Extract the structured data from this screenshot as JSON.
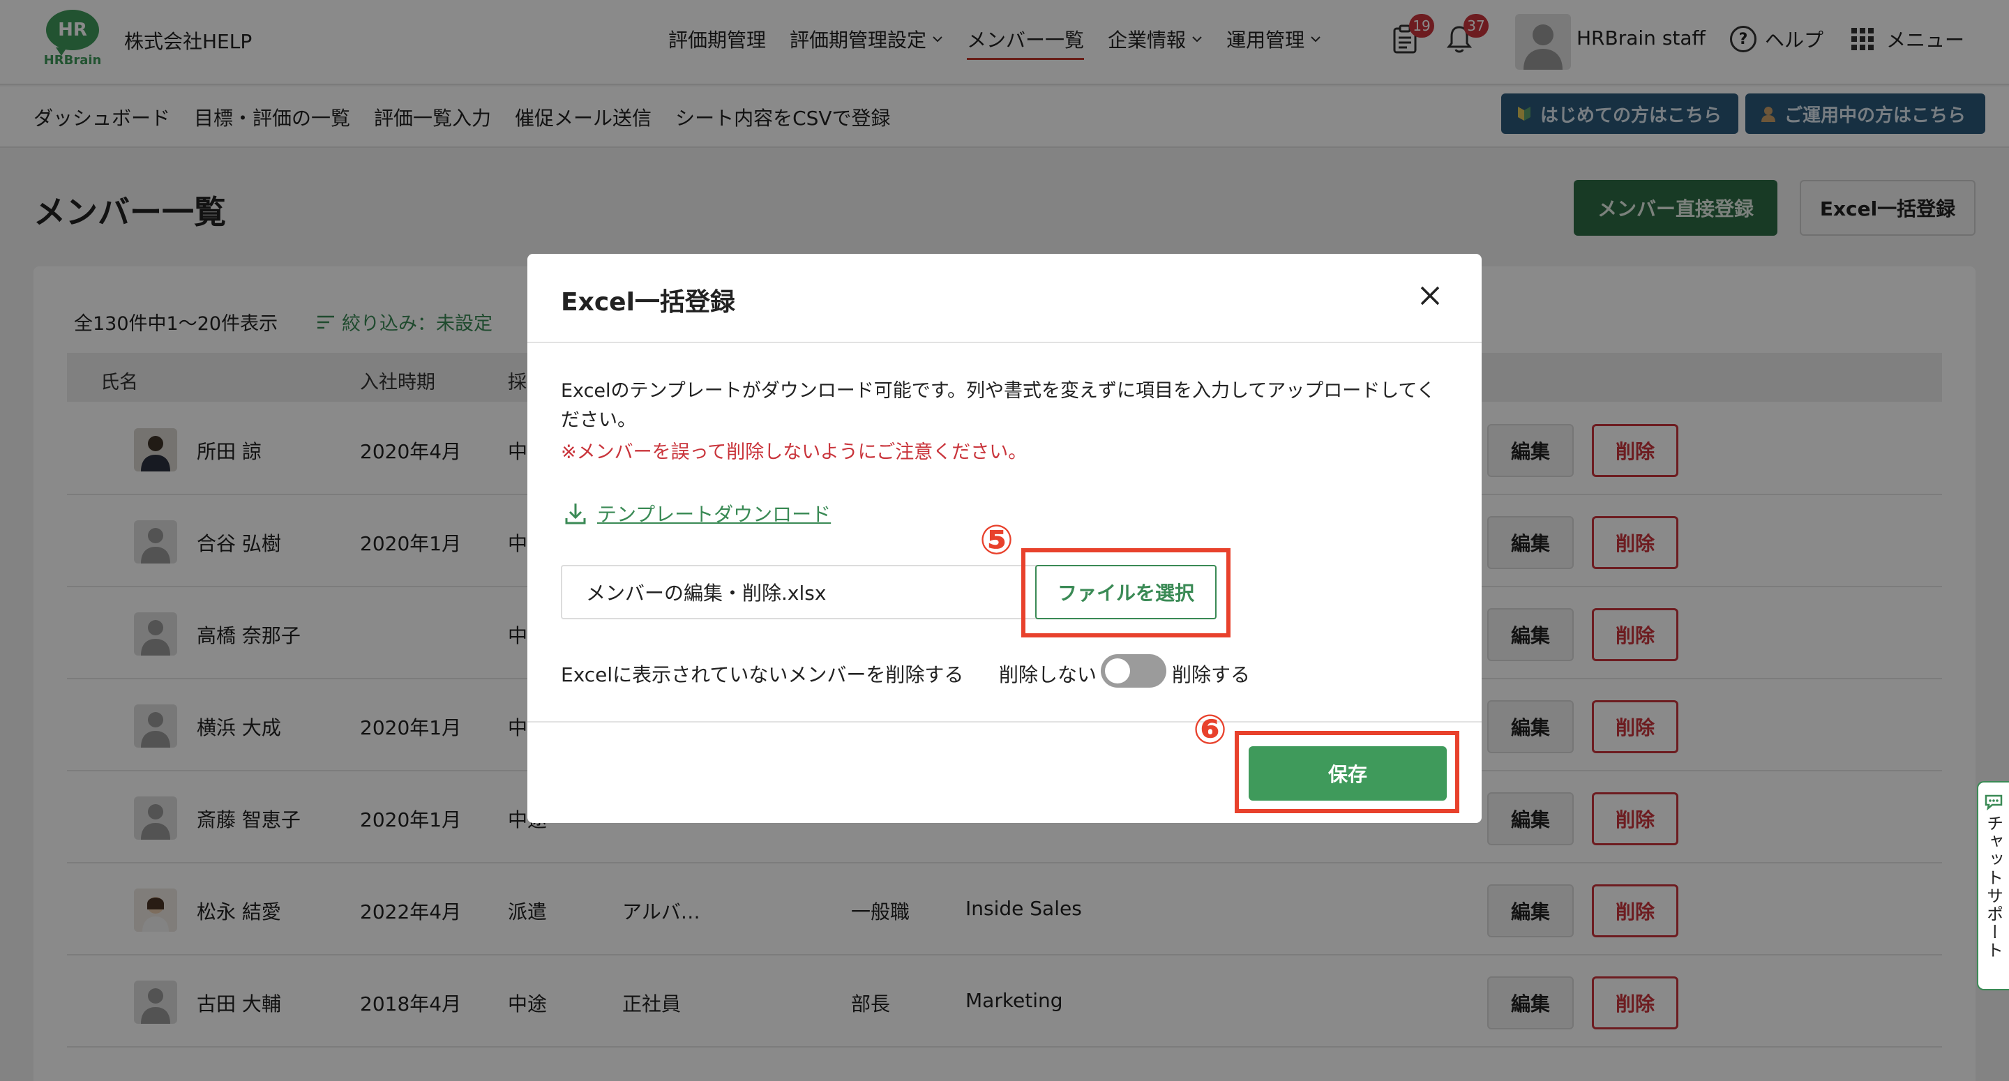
{
  "header": {
    "logo_text": "HR",
    "logo_subtext": "HRBrain",
    "company": "株式会社HELP",
    "nav": [
      {
        "label": "評価期管理",
        "dropdown": false,
        "active": false
      },
      {
        "label": "評価期管理設定",
        "dropdown": true,
        "active": false
      },
      {
        "label": "メンバー一覧",
        "dropdown": false,
        "active": true
      },
      {
        "label": "企業情報",
        "dropdown": true,
        "active": false
      },
      {
        "label": "運用管理",
        "dropdown": true,
        "active": false
      }
    ],
    "clipboard_badge": "19",
    "bell_badge": "37",
    "user_name": "HRBrain staff",
    "help_label": "ヘルプ",
    "menu_label": "メニュー"
  },
  "subnav": {
    "items": [
      "ダッシュボード",
      "目標・評価の一覧",
      "評価一覧入力",
      "催促メール送信",
      "シート内容をCSVで登録"
    ],
    "guide_beginner": "はじめての方はこちら",
    "guide_existing": "ご運用中の方はこちら"
  },
  "page": {
    "title": "メンバー一覧",
    "btn_direct_register": "メンバー直接登録",
    "btn_excel_register": "Excel一括登録",
    "count_text": "全130件中1〜20件表示",
    "filter_text": "絞り込み：未設定",
    "columns": [
      "氏名",
      "入社時期",
      "採用区"
    ],
    "rows": [
      {
        "name": "所田 諒",
        "joined": "2020年4月",
        "type": "中途",
        "employment": "",
        "position": "",
        "dept": ""
      },
      {
        "name": "合谷 弘樹",
        "joined": "2020年1月",
        "type": "中途",
        "employment": "",
        "position": "",
        "dept": ""
      },
      {
        "name": "高橋 奈那子",
        "joined": "",
        "type": "中途",
        "employment": "",
        "position": "",
        "dept": ""
      },
      {
        "name": "横浜 大成",
        "joined": "2020年1月",
        "type": "中途",
        "employment": "",
        "position": "",
        "dept": ""
      },
      {
        "name": "斎藤 智恵子",
        "joined": "2020年1月",
        "type": "中途",
        "employment": "",
        "position": "",
        "dept": ""
      },
      {
        "name": "松永 結愛",
        "joined": "2022年4月",
        "type": "派遣",
        "employment": "アルバ…",
        "position": "一般職",
        "dept": "Inside Sales"
      },
      {
        "name": "古田 大輔",
        "joined": "2018年4月",
        "type": "中途",
        "employment": "正社員",
        "position": "部長",
        "dept": "Marketing"
      }
    ],
    "edit_label": "編集",
    "delete_label": "削除"
  },
  "chat": {
    "label": "チャットサポート"
  },
  "modal": {
    "title": "Excel一括登録",
    "desc": "Excelのテンプレートがダウンロード可能です。列や書式を変えずに項目を入力してアップロードしてください。",
    "warning": "※メンバーを誤って削除しないようにご注意ください。",
    "download_link": "テンプレートダウンロード",
    "file_name": "メンバーの編集・削除.xlsx",
    "file_button": "ファイルを選択",
    "delete_option_label": "Excelに表示されていないメンバーを削除する",
    "toggle_off": "削除しない",
    "toggle_on": "削除する",
    "toggle_state": "off",
    "save_button": "保存"
  },
  "annotations": {
    "step5": "⑤",
    "step6": "⑥",
    "color": "#e8412c"
  },
  "colors": {
    "brand_green": "#3f9a5b",
    "danger_red": "#c9343b",
    "guide_blue": "#2c5a7a"
  }
}
